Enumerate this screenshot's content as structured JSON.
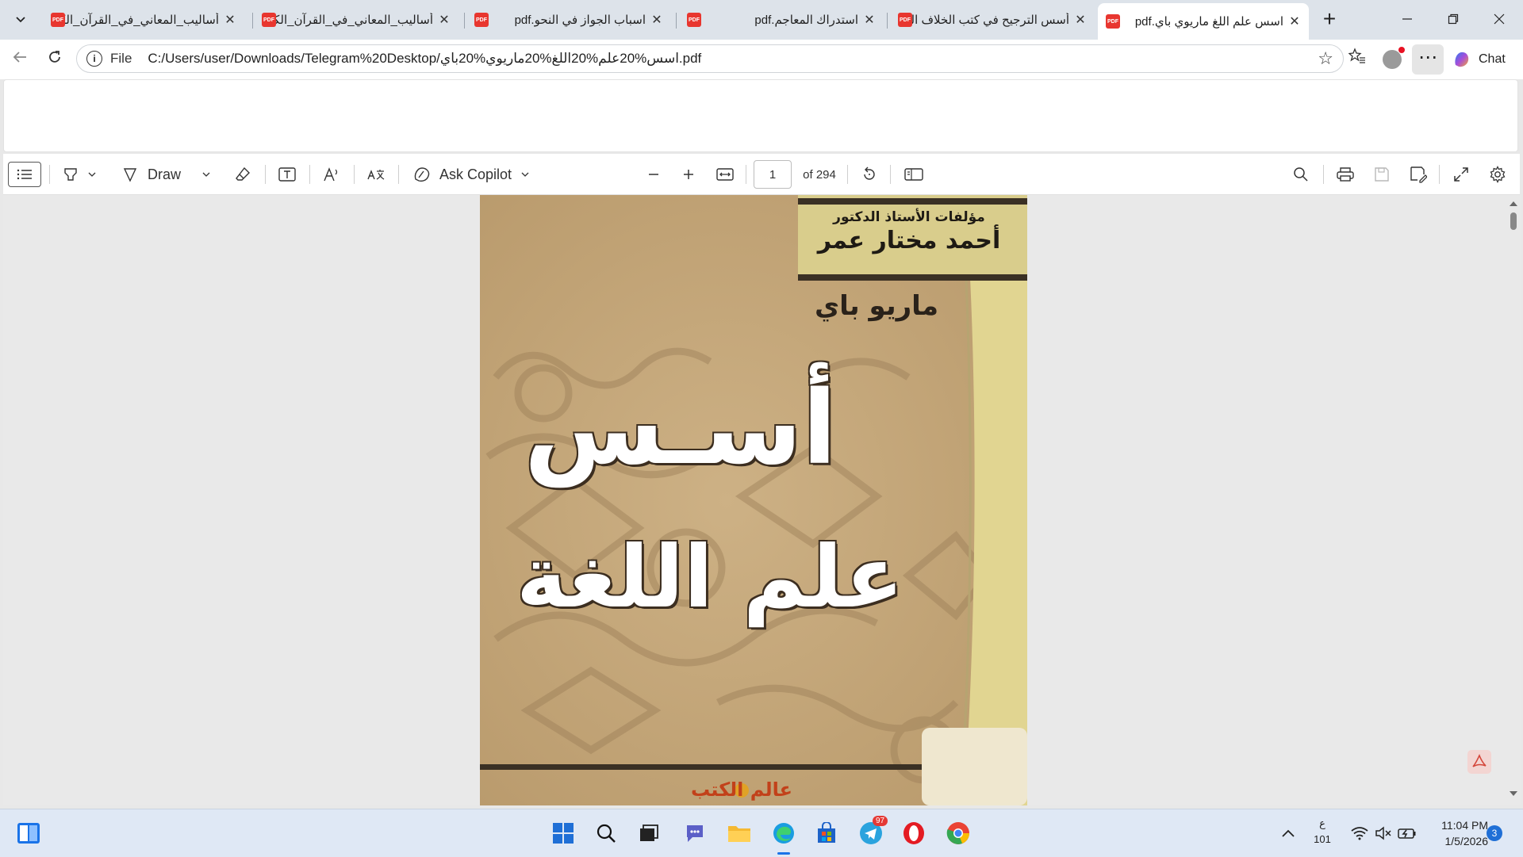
{
  "tabs": [
    {
      "title": "أساليب_المعاني_في_القرآن_الكريم",
      "active": false
    },
    {
      "title": "أساليب_المعاني_في_القرآن_الكريم",
      "active": false
    },
    {
      "title": "اسباب الجواز في النحو.pdf",
      "active": false
    },
    {
      "title": "استدراك المعاجم.pdf",
      "active": false
    },
    {
      "title": "أسس الترجيح في كتب الخلاف النحوي",
      "active": false
    },
    {
      "title": "اسس علم اللغ ماريوي باي.pdf",
      "active": true
    }
  ],
  "address": {
    "scheme": "File",
    "url": "C:/Users/user/Downloads/Telegram%20Desktop/اسس%20علم%20اللغ%20ماريوي%20باي.pdf"
  },
  "copilot_chat_label": "Chat",
  "pdf_toolbar": {
    "draw_label": "Draw",
    "ask_copilot_label": "Ask Copilot",
    "page_number": "1",
    "page_total": "of 294"
  },
  "book_cover": {
    "series": "مؤلفات الأستاذ الدكتور",
    "translator": "أحمد مختار عمر",
    "author": "ماريو باي",
    "title_line1": "أسـس",
    "title_line2": "علم اللغة",
    "publisher": "عالم الكتب"
  },
  "taskbar": {
    "lang_top": "ع",
    "lang_bottom": "101",
    "time": "11:04 PM",
    "date": "1/5/2026",
    "notification_count": "3",
    "telegram_badge": "97"
  },
  "colors": {
    "tabstrip": "#dde3ea",
    "pdf_red": "#e8362f",
    "cover_tan": "#c9ad7f",
    "cover_yellow": "#e3d693"
  }
}
